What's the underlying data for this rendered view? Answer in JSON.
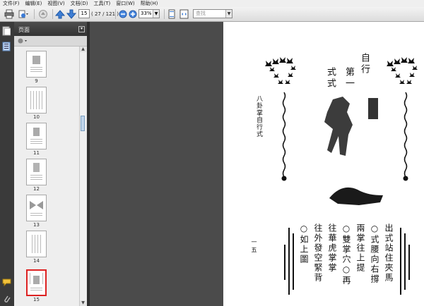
{
  "menu": {
    "items": [
      {
        "label": "文件(F)"
      },
      {
        "label": "编辑(E)"
      },
      {
        "label": "视图(V)"
      },
      {
        "label": "文档(D)"
      },
      {
        "label": "工具(T)"
      },
      {
        "label": "窗口(W)"
      },
      {
        "label": "帮助(H)"
      }
    ]
  },
  "toolbar": {
    "page_number": "15",
    "page_count": "( 27 / 121 )",
    "zoom": "33%",
    "zoom_arrow": "▼",
    "search_placeholder": "查找",
    "search_arrow": "▼"
  },
  "panel": {
    "title": "页面",
    "options_icon": "▾",
    "thumbnails": [
      {
        "label": "9"
      },
      {
        "label": "10"
      },
      {
        "label": "11"
      },
      {
        "label": "12"
      },
      {
        "label": "13"
      },
      {
        "label": "14"
      },
      {
        "label": "15",
        "selected": true
      }
    ]
  },
  "document": {
    "title_col1": "自行",
    "title_col2": "第一",
    "title_col3": "式式",
    "side_label": "八卦掌自行式",
    "page_mark": "一五",
    "text_columns": [
      "出式站住夾馬",
      "○式腰向右撐",
      "兩掌往上提",
      "○雙掌穴○再",
      "往華虎掌掌",
      "往外發空緊背",
      "○如上圖"
    ]
  },
  "colors": {
    "chrome_dark": "#3a3a3a",
    "panel_bg": "#e6e6e6",
    "selected_thumb": "#dd2222",
    "workspace": "#4b4b4b"
  }
}
